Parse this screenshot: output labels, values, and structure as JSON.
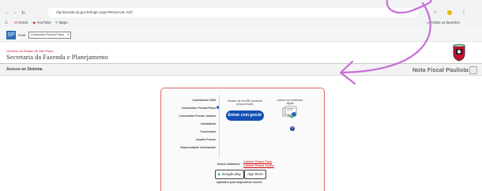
{
  "browser": {
    "url": "nfp.fazenda.sp.gov.br/login.aspx?ReturnUrl=%2f",
    "bookmarks": [
      "Gmail",
      "YouTube",
      "Maps"
    ],
    "all_bookmarks": "Todos os favoritos"
  },
  "gov_bar": {
    "logo": "SP",
    "label": "Perfil:",
    "select_value": "Consumidor Pessoa Física"
  },
  "header": {
    "agency": "Governo do Estado de São Paulo",
    "title": "Secretaria da Fazenda e Planejamento",
    "section": "Acesso ao Sistema",
    "product": "Nota Fiscal Paulista"
  },
  "login": {
    "menu": [
      "Contribuinte ICMS",
      "Consumidor Pessoa Física",
      "Consumidor Pessoa Jurídica",
      "Contabilista",
      "Funcionário",
      "Usuário Procon",
      "Representante Contribuinte"
    ],
    "govbr_caption": "Acesse via Gov.BR (somente pessoa física)",
    "govbr_button": "Entrar com gov.br",
    "cert_caption": "Acesso via certificado digital",
    "novos_label": "Novos Cadastros:",
    "links": [
      "Cadastro Pessoa Física",
      "Cadastro Pessoa Jurídica"
    ],
    "store_google": "Google play",
    "store_apple": "App Store",
    "apps_label": "Aplicativo para dispositivos móveis"
  },
  "colors": {
    "govbr_blue": "#1351b4",
    "panel_border": "#e06a66",
    "annotation": "#c86dd7"
  }
}
